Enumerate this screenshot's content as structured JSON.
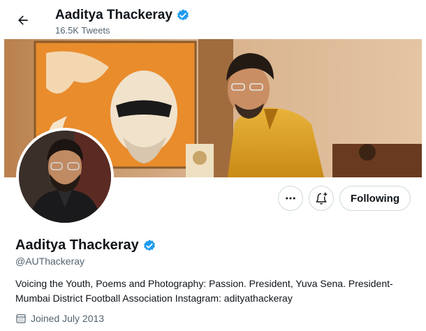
{
  "header": {
    "name": "Aaditya Thackeray",
    "tweets_count": "16.5K Tweets"
  },
  "actions": {
    "more_icon": "more-icon",
    "notify_icon": "bell-plus-icon",
    "follow_label": "Following"
  },
  "profile": {
    "name": "Aaditya Thackeray",
    "handle": "@AUThackeray",
    "bio": "Voicing the Youth, Poems and Photography: Passion. President, Yuva Sena. President- Mumbai District Football Association Instagram: adityathackeray",
    "joined": "Joined July 2013"
  },
  "colors": {
    "verified": "#1d9bf0",
    "text": "#0f1419",
    "muted": "#536471",
    "border": "#cfd9de"
  }
}
